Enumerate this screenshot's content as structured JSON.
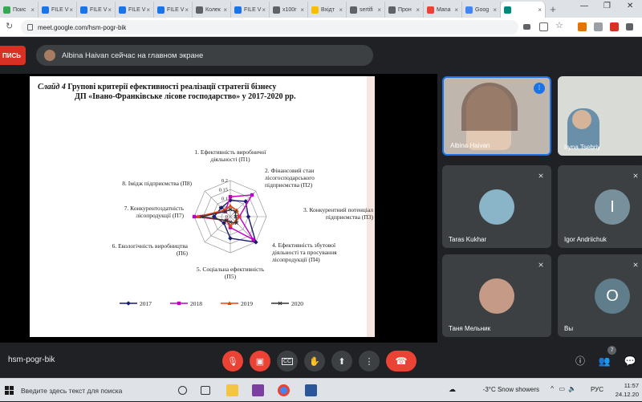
{
  "browser": {
    "tabs": [
      {
        "label": "Поис",
        "color": "#34a853"
      },
      {
        "label": "FILE V",
        "color": "#1a73e8"
      },
      {
        "label": "FILE V",
        "color": "#1a73e8"
      },
      {
        "label": "FILE V",
        "color": "#1a73e8"
      },
      {
        "label": "FILE V",
        "color": "#1a73e8"
      },
      {
        "label": "Колек",
        "color": "#5f6368"
      },
      {
        "label": "FILE V",
        "color": "#1a73e8"
      },
      {
        "label": "x100r",
        "color": "#5f6368"
      },
      {
        "label": "Вхідт",
        "color": "#fbbc04"
      },
      {
        "label": "sertifi",
        "color": "#5f6368"
      },
      {
        "label": "Прон",
        "color": "#5f6368"
      },
      {
        "label": "Mana",
        "color": "#ea4335"
      },
      {
        "label": "Goog",
        "color": "#4285f4"
      },
      {
        "label": "",
        "color": "#00897b"
      }
    ],
    "url": "meet.google.com/hsm-pogr-bik"
  },
  "meet": {
    "record_label": "ПИСЬ",
    "presenter_text": "Albina Haivan сейчас на главном экране",
    "meeting_code": "hsm-pogr-bik",
    "people_count": "7",
    "participants": [
      {
        "name": "Albina Haivan",
        "initial": ""
      },
      {
        "name": "Iryna Tsebriy",
        "initial": ""
      },
      {
        "name": "Taras Kukhar",
        "initial": ""
      },
      {
        "name": "Igor Andriichuk",
        "initial": "I"
      },
      {
        "name": "Таня Мельник",
        "initial": ""
      },
      {
        "name": "Вы",
        "initial": "O"
      }
    ]
  },
  "slide": {
    "number_label": "Слайд 4",
    "title_line1": "Групові критерії ефективності реалізації стратегії бізнесу",
    "title_line2": "ДП «Івано-Франківське лісове господарство» у 2017-2020 рр."
  },
  "chart_data": {
    "type": "radar",
    "axes": [
      "1. Ефективність виробничої діяльності (П1)",
      "2. Фінансовий стан лісогосподарського підприємства (П2)",
      "3. Конкурентний потенціал підприємства (П3)",
      "4. Ефективність збутової діяльності та просування лісопродукції (П4)",
      "5. Соціальна ефективність (П5)",
      "6. Екологічність виробництва (П6)",
      "7. Конкурентоздатність лісопродукції (П7)",
      "8. Імідж підприємства (П8)"
    ],
    "ticks": [
      "0",
      "0.05",
      "0.1",
      "0.15",
      "0.2"
    ],
    "rmax": 0.2,
    "series": [
      {
        "name": "2017",
        "color": "#1a1a6e",
        "marker": "diamond",
        "values": [
          0.09,
          0.12,
          0.1,
          0.2,
          0.12,
          0.05,
          0.09,
          0.07
        ]
      },
      {
        "name": "2018",
        "color": "#c000c0",
        "marker": "square",
        "values": [
          0.11,
          0.17,
          0.05,
          0.18,
          0.06,
          0.03,
          0.2,
          0.04
        ]
      },
      {
        "name": "2019",
        "color": "#e8420c",
        "marker": "triangle",
        "values": [
          0.06,
          0.05,
          0.05,
          0.04,
          0.05,
          0.03,
          0.18,
          0.05
        ]
      },
      {
        "name": "2020",
        "color": "#333333",
        "marker": "x",
        "values": [
          0.04,
          0.04,
          0.03,
          0.05,
          0.03,
          0.03,
          0.16,
          0.04
        ]
      }
    ]
  },
  "taskbar": {
    "search_placeholder": "Введите здесь текст для поиска",
    "weather": "-3°C  Snow showers",
    "lang": "РУС",
    "time": "11:57",
    "date": "24.12.20"
  }
}
